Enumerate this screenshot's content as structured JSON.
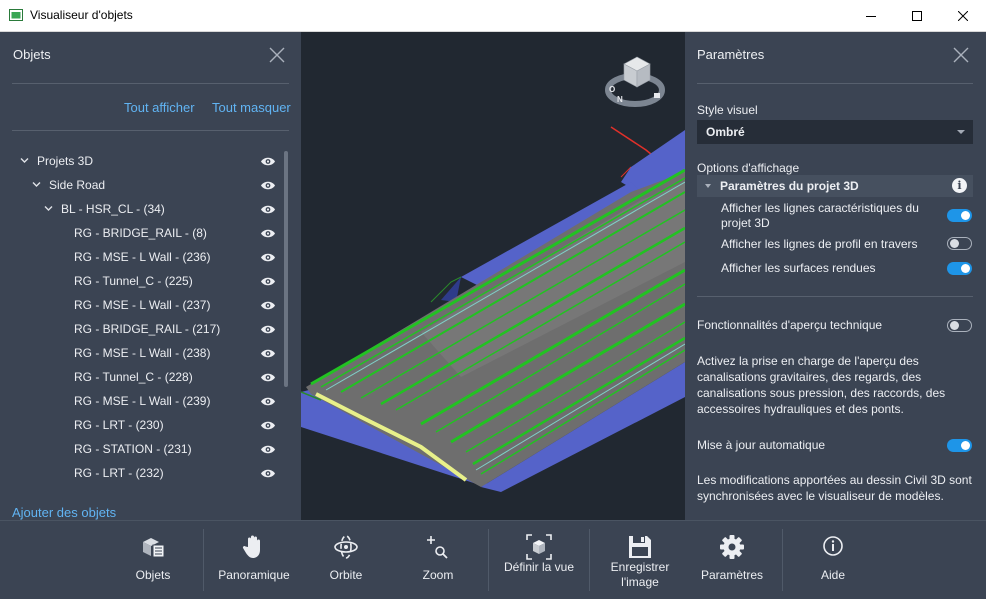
{
  "window": {
    "title": "Visualiseur d'objets"
  },
  "objects_panel": {
    "title": "Objets",
    "show_all": "Tout afficher",
    "hide_all": "Tout masquer",
    "add_objects": "Ajouter des objets",
    "tree": [
      {
        "label": "Projets 3D",
        "level": 0,
        "expanded": true
      },
      {
        "label": "Side Road",
        "level": 1,
        "expanded": true
      },
      {
        "label": "BL - HSR_CL - (34)",
        "level": 2,
        "expanded": true
      },
      {
        "label": "RG - BRIDGE_RAIL - (8)",
        "level": 3
      },
      {
        "label": "RG - MSE - L Wall - (236)",
        "level": 3
      },
      {
        "label": "RG - Tunnel_C - (225)",
        "level": 3
      },
      {
        "label": "RG - MSE - L Wall - (237)",
        "level": 3
      },
      {
        "label": "RG - BRIDGE_RAIL - (217)",
        "level": 3
      },
      {
        "label": "RG - MSE - L Wall - (238)",
        "level": 3
      },
      {
        "label": "RG - Tunnel_C - (228)",
        "level": 3
      },
      {
        "label": "RG - MSE - L Wall - (239)",
        "level": 3
      },
      {
        "label": "RG - LRT - (230)",
        "level": 3
      },
      {
        "label": "RG - STATION - (231)",
        "level": 3
      },
      {
        "label": "RG - LRT - (232)",
        "level": 3
      }
    ]
  },
  "viewcube": {
    "north": "N",
    "west": "O"
  },
  "settings_panel": {
    "title": "Paramètres",
    "visual_style_label": "Style visuel",
    "visual_style_value": "Ombré",
    "display_options_label": "Options d'affichage",
    "section_title": "Paramètres du projet 3D",
    "opt_feature_lines": "Afficher les lignes caractéristiques du projet 3D",
    "opt_feature_lines_on": true,
    "opt_cross_sections": "Afficher les lignes de profil en travers",
    "opt_cross_sections_on": false,
    "opt_rendered_surfaces": "Afficher les surfaces rendues",
    "opt_rendered_surfaces_on": true,
    "tech_preview_label": "Fonctionnalités d'aperçu technique",
    "tech_preview_on": false,
    "tech_preview_desc": "Activez la prise en charge de l'aperçu des canalisations gravitaires, des regards, des canalisations sous pression, des raccords, des accessoires hydrauliques et des ponts.",
    "auto_update_label": "Mise à jour automatique",
    "auto_update_on": true,
    "auto_update_desc": "Les modifications apportées au dessin Civil 3D sont synchronisées avec le visualiseur de modèles."
  },
  "toolbar": {
    "objects": "Objets",
    "pan": "Panoramique",
    "orbit": "Orbite",
    "zoom": "Zoom",
    "set_view": "Définir la vue",
    "save_image": "Enregistrer l'image",
    "settings": "Paramètres",
    "help": "Aide"
  },
  "colors": {
    "accent": "#1e95e8",
    "link": "#61b4f3",
    "panel": "#3b4453",
    "viewport": "#212831"
  }
}
